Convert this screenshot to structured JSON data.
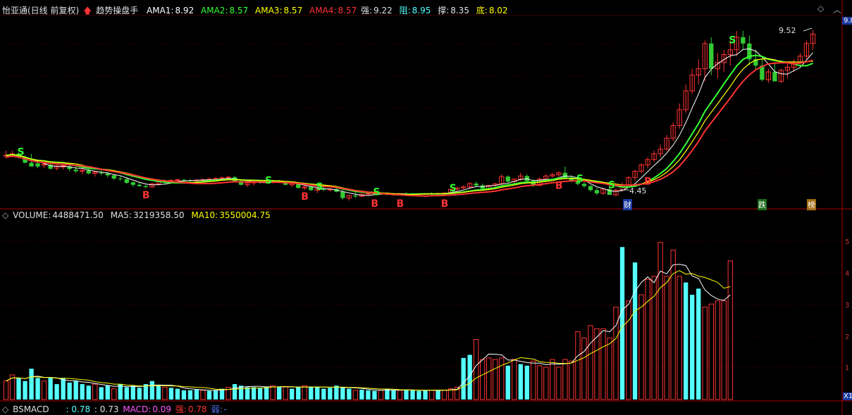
{
  "header": {
    "stock_name": "怡亚通(日线 前复权)",
    "indicator_name": "趋势操盘手",
    "ama1": {
      "label": "AMA1:",
      "value": "8.92",
      "color": "#ffffff"
    },
    "ama2": {
      "label": "AMA2:",
      "value": "8.57",
      "color": "#33ff33"
    },
    "ama3": {
      "label": "AMA3:",
      "value": "8.57",
      "color": "#ffff00"
    },
    "ama4": {
      "label": "AMA4:",
      "value": "8.57",
      "color": "#ff3333"
    },
    "strong": {
      "label": "强:",
      "value": "9.22"
    },
    "resist": {
      "label": "阻:",
      "value": "8.95"
    },
    "support": {
      "label": "撑:",
      "value": "8.35"
    },
    "bottom": {
      "label": "底:",
      "value": "8.02"
    }
  },
  "volume_header": {
    "volume": {
      "label": "VOLUME:",
      "value": "4488471.50"
    },
    "ma5": {
      "label": "MA5:",
      "value": "3219358.50"
    },
    "ma10": {
      "label": "MA10:",
      "value": "3550004.75"
    }
  },
  "macd_header": {
    "name": "BSMACD",
    "v1": ": 0.78",
    "v2": ": 0.73",
    "macd": {
      "label": "MACD:",
      "value": "0.09"
    },
    "strong": {
      "label": "强:",
      "value": "0.78"
    },
    "weak": {
      "label": "弱:",
      "value": "-"
    }
  },
  "annotations": {
    "high_price": "9.52",
    "low_price": "4.45",
    "tags": [
      "财",
      "跌",
      "榜"
    ],
    "buy_mark": "B",
    "sell_mark": "S"
  },
  "right_axis": {
    "price_top": "9.8",
    "volume_ticks": [
      "5",
      "4",
      "3",
      "2",
      "1"
    ],
    "volume_unit": "X1"
  },
  "colors": {
    "up": "#ff3333",
    "down": "#33cc33",
    "flat": "#ffffff",
    "vol_up": "#ff3333",
    "vol_down": "#55ffff",
    "grid": "#5a0000",
    "border": "#aa0000"
  },
  "chart_data": [
    {
      "type": "candlestick",
      "title": "怡亚通(日线 前复权)",
      "price_range": [
        3.9,
        9.9
      ],
      "ohlc": [
        [
          5.53,
          5.7,
          5.45,
          5.55
        ],
        [
          5.58,
          5.7,
          5.5,
          5.6
        ],
        [
          5.6,
          5.65,
          5.45,
          5.5
        ],
        [
          5.5,
          5.55,
          5.3,
          5.32
        ],
        [
          5.32,
          5.6,
          5.25,
          5.2
        ],
        [
          5.3,
          5.4,
          5.15,
          5.2
        ],
        [
          5.25,
          5.35,
          5.15,
          5.27
        ],
        [
          5.25,
          5.32,
          5.1,
          5.13
        ],
        [
          5.15,
          5.25,
          5.08,
          5.22
        ],
        [
          5.18,
          5.3,
          5.1,
          5.23
        ],
        [
          5.2,
          5.3,
          5.05,
          5.12
        ],
        [
          5.1,
          5.2,
          5.0,
          5.05
        ],
        [
          5.05,
          5.15,
          4.95,
          5.08
        ],
        [
          5.08,
          5.12,
          4.95,
          4.98
        ],
        [
          4.98,
          5.05,
          4.88,
          5.02
        ],
        [
          5.0,
          5.08,
          4.92,
          4.98
        ],
        [
          4.98,
          5.02,
          4.85,
          4.92
        ],
        [
          4.92,
          4.95,
          4.78,
          4.82
        ],
        [
          4.82,
          4.9,
          4.75,
          4.8
        ],
        [
          4.8,
          4.85,
          4.65,
          4.68
        ],
        [
          4.7,
          4.72,
          4.55,
          4.62
        ],
        [
          4.62,
          4.7,
          4.55,
          4.58
        ],
        [
          4.58,
          4.62,
          4.5,
          4.55
        ],
        [
          4.55,
          4.68,
          4.52,
          4.65
        ],
        [
          4.65,
          4.75,
          4.6,
          4.72
        ],
        [
          4.72,
          4.78,
          4.65,
          4.7
        ],
        [
          4.7,
          4.8,
          4.66,
          4.76
        ],
        [
          4.76,
          4.82,
          4.7,
          4.78
        ],
        [
          4.78,
          4.8,
          4.72,
          4.77
        ],
        [
          4.77,
          4.8,
          4.7,
          4.75
        ],
        [
          4.75,
          4.8,
          4.7,
          4.77
        ],
        [
          4.77,
          4.82,
          4.72,
          4.78
        ],
        [
          4.78,
          4.85,
          4.72,
          4.8
        ],
        [
          4.8,
          4.86,
          4.75,
          4.82
        ],
        [
          4.82,
          4.88,
          4.76,
          4.84
        ],
        [
          4.84,
          4.9,
          4.78,
          4.86
        ],
        [
          4.86,
          4.9,
          4.72,
          4.74
        ],
        [
          4.74,
          4.8,
          4.6,
          4.62
        ],
        [
          4.62,
          4.7,
          4.55,
          4.68
        ],
        [
          4.68,
          4.75,
          4.6,
          4.72
        ],
        [
          4.72,
          4.76,
          4.65,
          4.7
        ],
        [
          4.7,
          4.75,
          4.65,
          4.72
        ],
        [
          4.72,
          4.78,
          4.66,
          4.74
        ],
        [
          4.74,
          4.78,
          4.68,
          4.7
        ],
        [
          4.7,
          4.74,
          4.6,
          4.62
        ],
        [
          4.62,
          4.7,
          4.55,
          4.66
        ],
        [
          4.66,
          4.68,
          4.5,
          4.52
        ],
        [
          4.52,
          4.6,
          4.45,
          4.55
        ],
        [
          4.55,
          4.6,
          4.42,
          4.45
        ],
        [
          4.45,
          4.55,
          4.36,
          4.5
        ],
        [
          4.5,
          4.56,
          4.42,
          4.46
        ],
        [
          4.46,
          4.52,
          4.4,
          4.48
        ],
        [
          4.48,
          4.55,
          4.38,
          4.4
        ],
        [
          4.4,
          4.45,
          4.15,
          4.2
        ],
        [
          4.2,
          4.3,
          4.12,
          4.28
        ],
        [
          4.28,
          4.38,
          4.2,
          4.25
        ],
        [
          4.25,
          4.35,
          4.22,
          4.32
        ],
        [
          4.32,
          4.38,
          4.28,
          4.34
        ],
        [
          4.34,
          4.38,
          4.3,
          4.35
        ],
        [
          4.35,
          4.4,
          4.3,
          4.34
        ],
        [
          4.34,
          4.38,
          4.28,
          4.33
        ],
        [
          4.33,
          4.36,
          4.28,
          4.32
        ],
        [
          4.32,
          4.35,
          4.28,
          4.34
        ],
        [
          4.34,
          4.38,
          4.3,
          4.33
        ],
        [
          4.33,
          4.36,
          4.28,
          4.31
        ],
        [
          4.31,
          4.35,
          4.27,
          4.33
        ],
        [
          4.33,
          4.36,
          4.3,
          4.34
        ],
        [
          4.34,
          4.38,
          4.3,
          4.33
        ],
        [
          4.33,
          4.36,
          4.28,
          4.35
        ],
        [
          4.35,
          4.38,
          4.32,
          4.36
        ],
        [
          4.36,
          4.5,
          4.34,
          4.48
        ],
        [
          4.48,
          4.55,
          4.4,
          4.52
        ],
        [
          4.52,
          4.6,
          4.48,
          4.55
        ],
        [
          4.55,
          4.7,
          4.5,
          4.66
        ],
        [
          4.66,
          4.72,
          4.55,
          4.6
        ],
        [
          4.6,
          4.66,
          4.45,
          4.5
        ],
        [
          4.5,
          4.62,
          4.45,
          4.6
        ],
        [
          4.6,
          4.68,
          4.55,
          4.65
        ],
        [
          4.65,
          4.95,
          4.6,
          4.88
        ],
        [
          4.88,
          4.92,
          4.7,
          4.72
        ],
        [
          4.72,
          4.82,
          4.68,
          4.8
        ],
        [
          4.8,
          5.0,
          4.75,
          4.9
        ],
        [
          4.9,
          4.95,
          4.7,
          4.74
        ],
        [
          4.74,
          4.8,
          4.55,
          4.6
        ],
        [
          4.6,
          4.85,
          4.58,
          4.8
        ],
        [
          4.8,
          4.95,
          4.75,
          4.9
        ],
        [
          4.9,
          5.0,
          4.85,
          4.94
        ],
        [
          4.94,
          5.05,
          4.88,
          5.0
        ],
        [
          5.0,
          5.2,
          4.95,
          4.85
        ],
        [
          4.85,
          4.92,
          4.7,
          4.75
        ],
        [
          4.75,
          4.8,
          4.6,
          4.65
        ],
        [
          4.65,
          4.7,
          4.52,
          4.58
        ],
        [
          4.58,
          4.62,
          4.4,
          4.45
        ],
        [
          4.45,
          4.52,
          4.3,
          4.35
        ],
        [
          4.35,
          4.5,
          4.3,
          4.48
        ],
        [
          4.48,
          4.6,
          4.45,
          4.3
        ],
        [
          4.3,
          4.5,
          4.25,
          4.45
        ],
        [
          4.45,
          4.7,
          4.4,
          4.62
        ],
        [
          4.62,
          4.9,
          4.55,
          4.85
        ],
        [
          4.85,
          5.1,
          4.75,
          5.05
        ],
        [
          5.05,
          5.3,
          4.98,
          5.25
        ],
        [
          5.25,
          5.5,
          5.15,
          5.42
        ],
        [
          5.42,
          5.7,
          5.35,
          5.6
        ],
        [
          5.6,
          5.9,
          5.5,
          5.75
        ],
        [
          5.75,
          6.2,
          5.7,
          6.1
        ],
        [
          6.1,
          6.6,
          6.0,
          6.5
        ],
        [
          6.5,
          7.2,
          6.4,
          7.0
        ],
        [
          7.0,
          7.8,
          6.9,
          7.6
        ],
        [
          7.6,
          8.3,
          7.5,
          8.1
        ],
        [
          8.1,
          8.6,
          7.8,
          8.3
        ],
        [
          8.3,
          9.2,
          7.9,
          9.1
        ],
        [
          9.1,
          9.3,
          8.1,
          8.3
        ],
        [
          8.3,
          8.8,
          8.0,
          8.5
        ],
        [
          8.5,
          8.9,
          8.2,
          8.75
        ],
        [
          8.75,
          9.2,
          8.4,
          8.9
        ],
        [
          8.9,
          9.5,
          8.7,
          9.3
        ],
        [
          9.3,
          9.5,
          8.9,
          9.1
        ],
        [
          9.1,
          9.35,
          8.4,
          8.6
        ],
        [
          8.6,
          8.9,
          8.3,
          8.4
        ],
        [
          8.4,
          8.6,
          7.9,
          7.95
        ],
        [
          7.95,
          8.3,
          7.85,
          8.2
        ],
        [
          8.2,
          8.5,
          7.9,
          7.9
        ],
        [
          7.9,
          8.3,
          7.85,
          8.25
        ],
        [
          8.25,
          8.5,
          8.0,
          8.35
        ],
        [
          8.35,
          8.6,
          8.2,
          8.5
        ],
        [
          8.5,
          8.8,
          8.4,
          8.7
        ],
        [
          8.7,
          9.2,
          8.6,
          9.1
        ],
        [
          9.1,
          9.52,
          8.9,
          9.4
        ]
      ],
      "ama_lines": [
        {
          "name": "AMA1",
          "color": "#ffffff"
        },
        {
          "name": "AMA2",
          "color": "#33ff33"
        },
        {
          "name": "AMA3",
          "color": "#ffff00"
        },
        {
          "name": "AMA4",
          "color": "#ff3333"
        }
      ]
    },
    {
      "type": "bar",
      "title": "VOLUME",
      "ylim": [
        0,
        5.8
      ],
      "volume": [
        0.6,
        0.8,
        0.7,
        0.6,
        1.0,
        0.7,
        0.6,
        0.7,
        0.5,
        0.7,
        0.55,
        0.6,
        0.5,
        0.45,
        0.5,
        0.4,
        0.45,
        0.35,
        0.5,
        0.4,
        0.45,
        0.38,
        0.5,
        0.6,
        0.45,
        0.4,
        0.38,
        0.35,
        0.3,
        0.3,
        0.32,
        0.3,
        0.28,
        0.3,
        0.35,
        0.4,
        0.5,
        0.45,
        0.4,
        0.4,
        0.38,
        0.42,
        0.45,
        0.4,
        0.42,
        0.35,
        0.4,
        0.45,
        0.42,
        0.4,
        0.35,
        0.38,
        0.45,
        0.4,
        0.35,
        0.3,
        0.32,
        0.3,
        0.28,
        0.3,
        0.35,
        0.3,
        0.3,
        0.32,
        0.3,
        0.28,
        0.3,
        0.3,
        0.32,
        0.3,
        0.35,
        0.4,
        1.35,
        1.45,
        1.95,
        1.3,
        1.35,
        1.3,
        1.35,
        1.1,
        1.3,
        1.15,
        1.1,
        1.25,
        1.1,
        1.05,
        1.3,
        1.05,
        1.3,
        1.25,
        2.2,
        2.0,
        2.4,
        2.3,
        2.3,
        2.0,
        3.0,
        4.95,
        3.2,
        4.45,
        3.4,
        3.9,
        4.0,
        5.1,
        4.0,
        4.85,
        4.0,
        3.8,
        3.4,
        3.6,
        3.0,
        3.1,
        3.2,
        3.2,
        4.5
      ],
      "volume_up": [
        1,
        1,
        0,
        0,
        0,
        0,
        1,
        0,
        0,
        0,
        0,
        0,
        0,
        0,
        1,
        0,
        0,
        1,
        0,
        0,
        0,
        0,
        0,
        0,
        0,
        1,
        0,
        0,
        0,
        0,
        0,
        1,
        0,
        0,
        0,
        1,
        0,
        0,
        0,
        0,
        0,
        0,
        1,
        0,
        1,
        0,
        0,
        1,
        0,
        0,
        0,
        0,
        0,
        0,
        0,
        1,
        0,
        0,
        0,
        1,
        0,
        0,
        1,
        0,
        0,
        0,
        0,
        1,
        0,
        1,
        1,
        1,
        0,
        0,
        1,
        1,
        1,
        1,
        1,
        0,
        1,
        0,
        0,
        1,
        1,
        1,
        1,
        1,
        1,
        1,
        1,
        1,
        1,
        1,
        1,
        1,
        1,
        0,
        1,
        0,
        1,
        1,
        1,
        1,
        1,
        1,
        1,
        0,
        0,
        0,
        1,
        1,
        1,
        1,
        1
      ]
    }
  ]
}
